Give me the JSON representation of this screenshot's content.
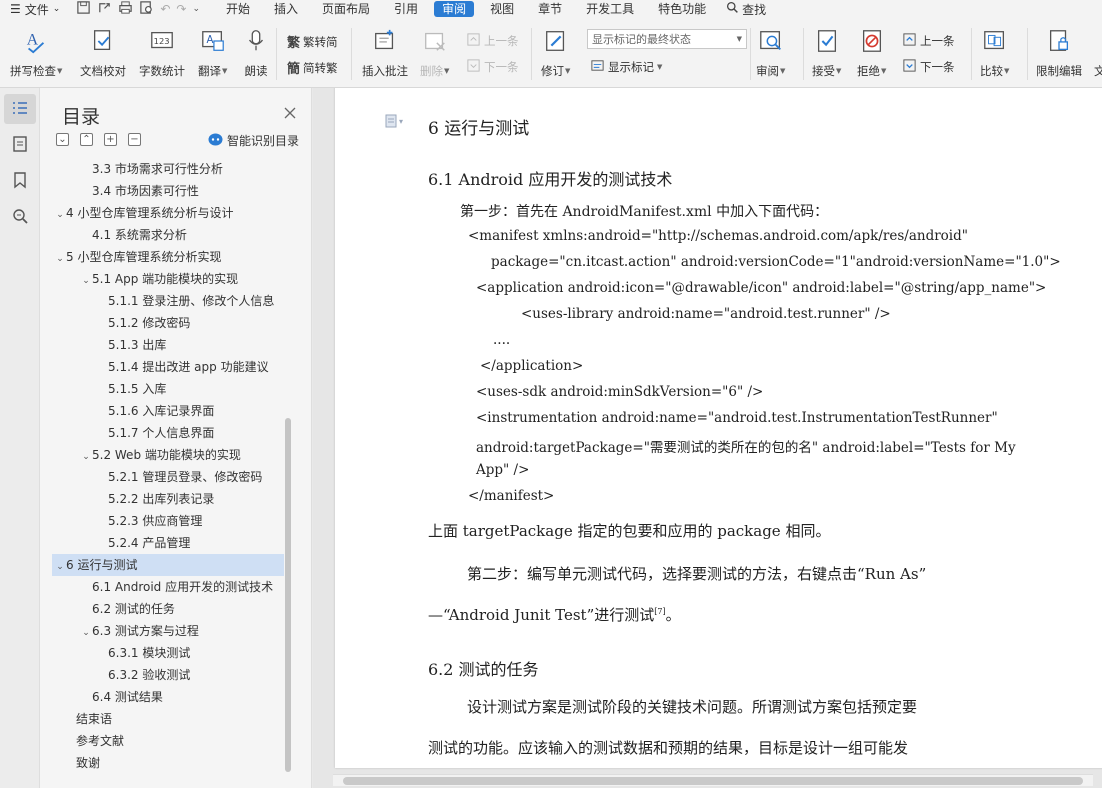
{
  "menu": {
    "file_label": "文件",
    "tabs": [
      "开始",
      "插入",
      "页面布局",
      "引用",
      "审阅",
      "视图",
      "章节",
      "开发工具",
      "特色功能"
    ],
    "active_tab": "审阅",
    "search_label": "查找"
  },
  "ribbon": {
    "spell_check": "拼写检查",
    "doc_proof": "文档校对",
    "word_count": "字数统计",
    "translate": "翻译",
    "read_aloud": "朗读",
    "trad_to_simp": "繁转简",
    "simp_to_trad": "简转繁",
    "insert_comment": "插入批注",
    "delete": "删除",
    "prev_comment": "上一条",
    "next_comment": "下一条",
    "revise": "修订",
    "show_state": "显示标记的最终状态",
    "show_markup": "显示标记",
    "review": "审阅",
    "accept": "接受",
    "reject": "拒绝",
    "prev_change": "上一条",
    "next_change": "下一条",
    "compare": "比较",
    "restrict_edit": "限制编辑",
    "more": "文"
  },
  "toc": {
    "title": "目录",
    "smart_label": "智能识别目录",
    "items": [
      {
        "text": "3.3 市场需求可行性分析",
        "level": 2,
        "arrow": ""
      },
      {
        "text": "3.4  市场因素可行性",
        "level": 2,
        "arrow": ""
      },
      {
        "text": "4  小型仓库管理系统分析与设计",
        "level": 1,
        "arrow": "v"
      },
      {
        "text": "4.1  系统需求分析",
        "level": 2,
        "arrow": ""
      },
      {
        "text": "5  小型仓库管理系统分析实现",
        "level": 1,
        "arrow": "v"
      },
      {
        "text": "5.1 App 端功能模块的实现",
        "level": 2,
        "arrow": "v"
      },
      {
        "text": "5.1.1  登录注册、修改个人信息",
        "level": 3,
        "arrow": ""
      },
      {
        "text": "5.1.2 修改密码",
        "level": 3,
        "arrow": ""
      },
      {
        "text": "5.1.3 出库",
        "level": 3,
        "arrow": ""
      },
      {
        "text": "5.1.4 提出改进 app 功能建议",
        "level": 3,
        "arrow": ""
      },
      {
        "text": "5.1.5 入库",
        "level": 3,
        "arrow": ""
      },
      {
        "text": "5.1.6 入库记录界面",
        "level": 3,
        "arrow": ""
      },
      {
        "text": "5.1.7 个人信息界面",
        "level": 3,
        "arrow": ""
      },
      {
        "text": "5.2 Web 端功能模块的实现",
        "level": 2,
        "arrow": "v"
      },
      {
        "text": "5.2.1 管理员登录、修改密码",
        "level": 3,
        "arrow": ""
      },
      {
        "text": "5.2.2  出库列表记录",
        "level": 3,
        "arrow": ""
      },
      {
        "text": "5.2.3  供应商管理",
        "level": 3,
        "arrow": ""
      },
      {
        "text": "5.2.4 产品管理",
        "level": 3,
        "arrow": ""
      },
      {
        "text": "6  运行与测试",
        "level": 1,
        "arrow": "v",
        "selected": true
      },
      {
        "text": "6.1 Android 应用开发的测试技术",
        "level": 2,
        "arrow": ""
      },
      {
        "text": "6.2  测试的任务",
        "level": 2,
        "arrow": ""
      },
      {
        "text": "6.3  测试方案与过程",
        "level": 2,
        "arrow": "v"
      },
      {
        "text": "6.3.1  模块测试",
        "level": 3,
        "arrow": ""
      },
      {
        "text": "6.3.2  验收测试",
        "level": 3,
        "arrow": ""
      },
      {
        "text": "6.4  测试结果",
        "level": 2,
        "arrow": ""
      },
      {
        "text": "结束语",
        "level": 0,
        "arrow": ""
      },
      {
        "text": "参考文献",
        "level": 0,
        "arrow": ""
      },
      {
        "text": "致谢",
        "level": 0,
        "arrow": ""
      }
    ]
  },
  "doc": {
    "h1": "6  运行与测试",
    "h2_1": "6.1 Android 应用开发的测试技术",
    "step1": "第一步：首先在 AndroidManifest.xml 中加入下面代码：",
    "code": [
      "<manifest xmlns:android=\"http://schemas.android.com/apk/res/android\"",
      "package=\"cn.itcast.action\" android:versionCode=\"1\"android:versionName=\"1.0\">",
      "<application android:icon=\"@drawable/icon\" android:label=\"@string/app_name\">",
      "<uses-library android:name=\"android.test.runner\" />",
      "....",
      "</application>",
      "<uses-sdk android:minSdkVersion=\"6\" />",
      "<instrumentation android:name=\"android.test.InstrumentationTestRunner\"",
      "android:targetPackage=\"需要测试的类所在的包的名\" android:label=\"Tests for My",
      "App\" />",
      "</manifest>"
    ],
    "para1": "上面 targetPackage 指定的包要和应用的 package 相同。",
    "para2_a": "第二步：编写单元测试代码，选择要测试的方法，右键点击“Run As”",
    "para2_b": "—“Android Junit Test”进行测试",
    "para2_ref": "[7]",
    "para2_end": "。",
    "h2_2": "6.2  测试的任务",
    "para3_a": "设计测试方案是测试阶段的关键技术问题。所谓测试方案包括预定要",
    "para3_b": "测试的功能。应该输入的测试数据和预期的结果，目标是设计一组可能发"
  }
}
